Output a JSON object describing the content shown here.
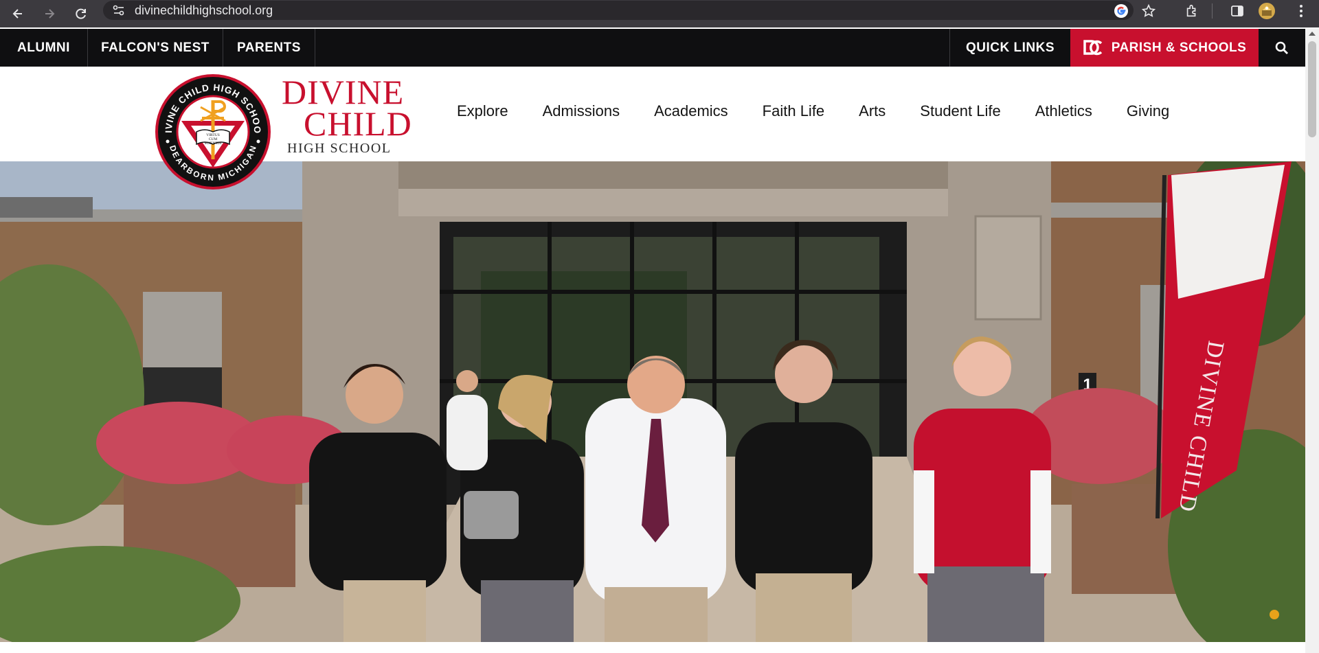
{
  "browser": {
    "url": "divinechildhighschool.org",
    "icons": [
      "back-arrow-icon",
      "forward-arrow-icon",
      "reload-icon",
      "site-settings-icon",
      "google-icon",
      "star-icon",
      "extensions-icon",
      "side-panel-icon",
      "profile-avatar",
      "menu-dots-icon"
    ]
  },
  "utility_bar": {
    "left_items": [
      "ALUMNI",
      "FALCON'S NEST",
      "PARENTS"
    ],
    "quick_links": "QUICK LINKS",
    "parish_schools": "PARISH & SCHOOLS",
    "search_icon": "search-icon"
  },
  "header": {
    "crest": {
      "top_text": "DIVINE CHILD HIGH SCHOOL",
      "bottom_text": "DEARBORN MICHIGAN",
      "motto": [
        "VIRTUS",
        "CUM",
        "SCIENTIA"
      ]
    },
    "wordmark": {
      "line1": "DIVINE",
      "line2": "CHILD",
      "line3": "HIGH SCHOOL"
    },
    "nav": [
      "Explore",
      "Admissions",
      "Academics",
      "Faith Life",
      "Arts",
      "Student Life",
      "Athletics",
      "Giving"
    ]
  },
  "hero": {
    "banner_text": "DIVINE CHILD",
    "door_number": "1"
  },
  "colors": {
    "brand_red": "#c8102e",
    "utility_bg": "#0f0f11",
    "chrome_bg": "#3c3a3f",
    "status_dot": "#e8a21a"
  }
}
